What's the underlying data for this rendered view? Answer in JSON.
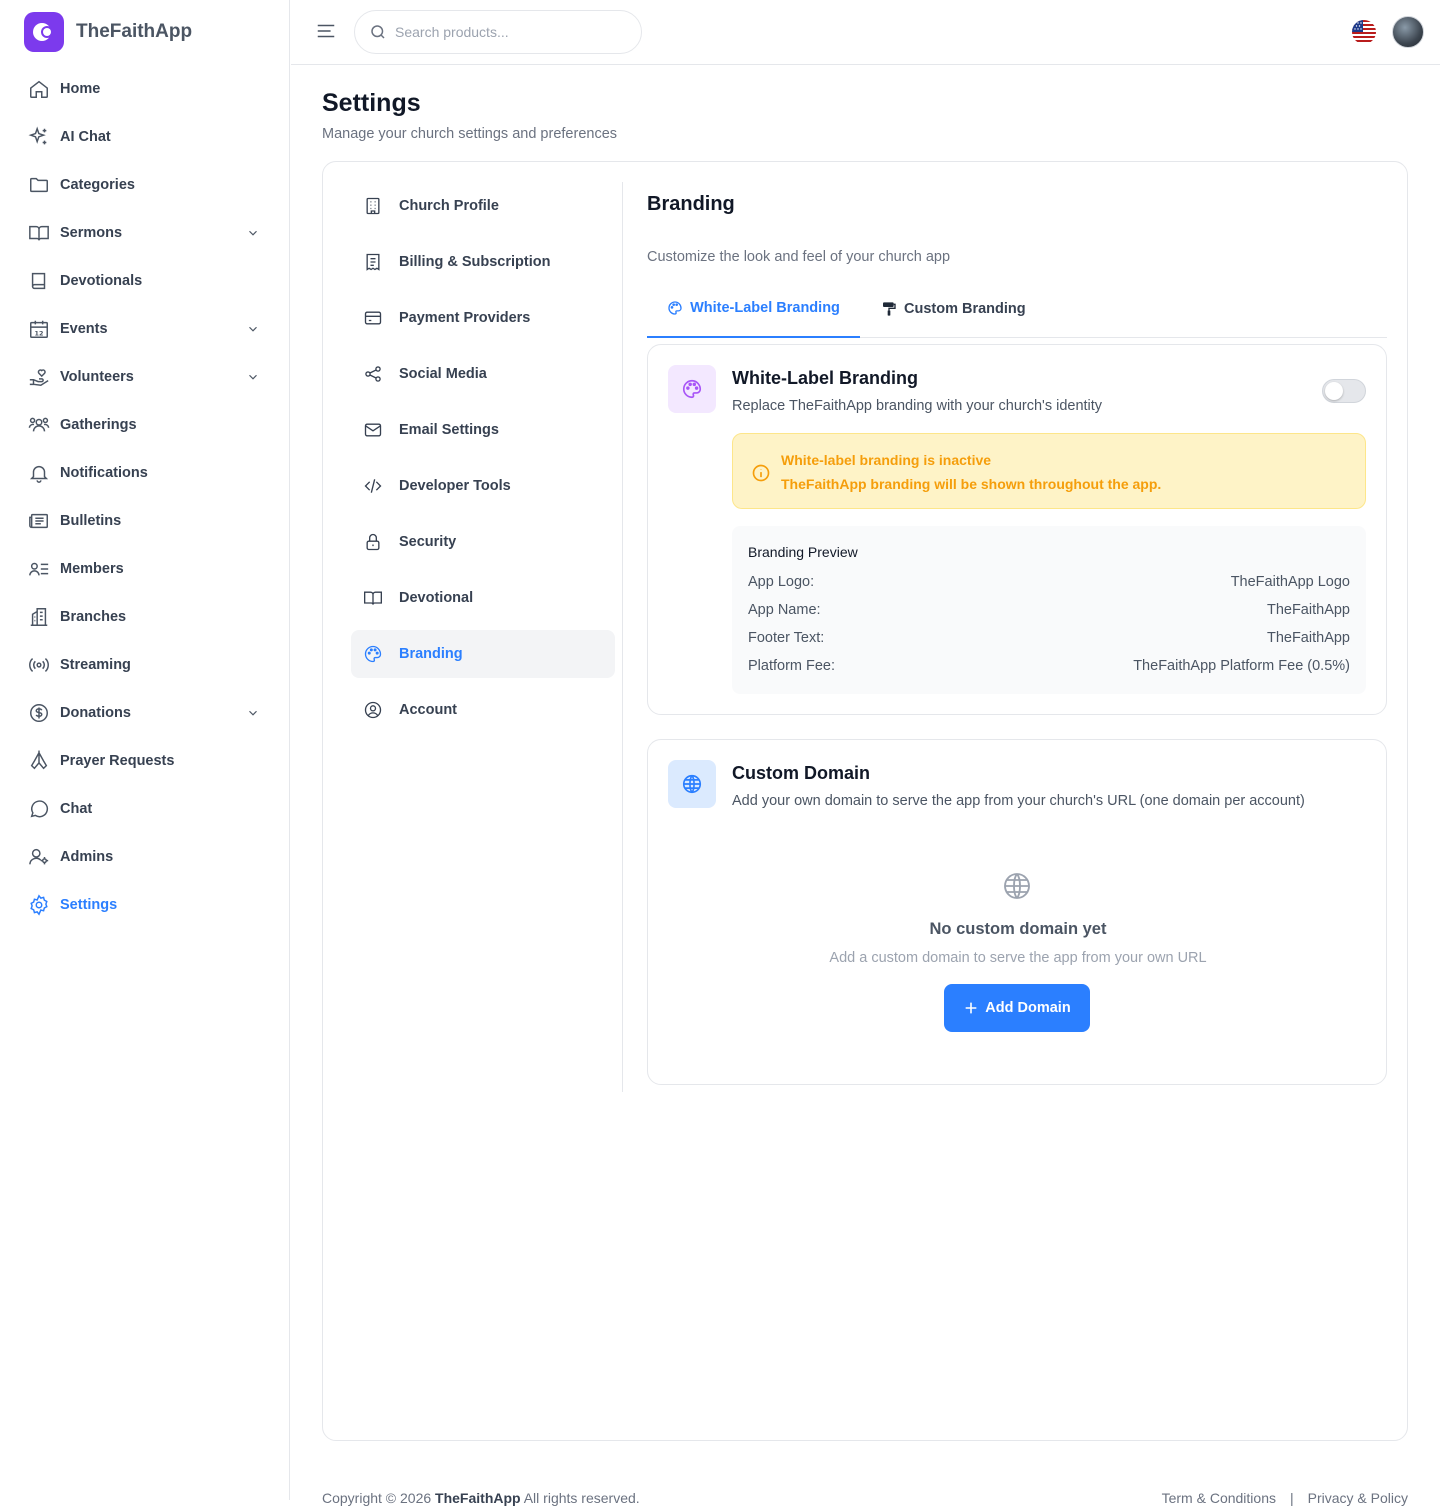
{
  "app": {
    "name": "TheFaithApp"
  },
  "sidebar": {
    "items": [
      {
        "label": "Home",
        "icon": "home-icon"
      },
      {
        "label": "AI Chat",
        "icon": "sparkles-icon"
      },
      {
        "label": "Categories",
        "icon": "folder-icon"
      },
      {
        "label": "Sermons",
        "icon": "book-open-icon",
        "expandable": true
      },
      {
        "label": "Devotionals",
        "icon": "book-icon"
      },
      {
        "label": "Events",
        "icon": "calendar-icon",
        "expandable": true
      },
      {
        "label": "Volunteers",
        "icon": "hand-heart-icon",
        "expandable": true
      },
      {
        "label": "Gatherings",
        "icon": "users-icon"
      },
      {
        "label": "Notifications",
        "icon": "bell-icon"
      },
      {
        "label": "Bulletins",
        "icon": "newspaper-icon"
      },
      {
        "label": "Members",
        "icon": "user-list-icon"
      },
      {
        "label": "Branches",
        "icon": "building-icon"
      },
      {
        "label": "Streaming",
        "icon": "radio-icon"
      },
      {
        "label": "Donations",
        "icon": "dollar-circle-icon",
        "expandable": true
      },
      {
        "label": "Prayer Requests",
        "icon": "praying-hands-icon"
      },
      {
        "label": "Chat",
        "icon": "message-circle-icon"
      },
      {
        "label": "Admins",
        "icon": "user-cog-icon"
      },
      {
        "label": "Settings",
        "icon": "gear-icon",
        "active": true
      }
    ]
  },
  "topbar": {
    "search_placeholder": "Search products..."
  },
  "page": {
    "title": "Settings",
    "subtitle": "Manage your church settings and preferences"
  },
  "settings_nav": {
    "items": [
      {
        "label": "Church Profile",
        "icon": "building-icon"
      },
      {
        "label": "Billing & Subscription",
        "icon": "receipt-icon"
      },
      {
        "label": "Payment Providers",
        "icon": "credit-card-icon"
      },
      {
        "label": "Social Media",
        "icon": "share-icon"
      },
      {
        "label": "Email Settings",
        "icon": "mail-icon"
      },
      {
        "label": "Developer Tools",
        "icon": "code-icon"
      },
      {
        "label": "Security",
        "icon": "lock-icon"
      },
      {
        "label": "Devotional",
        "icon": "book-open-icon"
      },
      {
        "label": "Branding",
        "icon": "palette-icon",
        "active": true
      },
      {
        "label": "Account",
        "icon": "user-circle-icon"
      }
    ]
  },
  "branding": {
    "title": "Branding",
    "subtitle": "Customize the look and feel of your church app",
    "tabs": [
      {
        "label": "White-Label Branding",
        "active": true
      },
      {
        "label": "Custom Branding"
      }
    ],
    "white_label": {
      "title": "White-Label Branding",
      "subtitle": "Replace TheFaithApp branding with your church's identity",
      "enabled": false,
      "alert_title": "White-label branding is inactive",
      "alert_text": "TheFaithApp branding will be shown throughout the app.",
      "preview_title": "Branding Preview",
      "preview_rows": [
        {
          "label": "App Logo:",
          "value": "TheFaithApp Logo"
        },
        {
          "label": "App Name:",
          "value": "TheFaithApp"
        },
        {
          "label": "Footer Text:",
          "value": "TheFaithApp"
        },
        {
          "label": "Platform Fee:",
          "value": "TheFaithApp Platform Fee (0.5%)"
        }
      ]
    },
    "custom_domain": {
      "title": "Custom Domain",
      "subtitle": "Add your own domain to serve the app from your church's URL (one domain per account)",
      "empty_title": "No custom domain yet",
      "empty_subtitle": "Add a custom domain to serve the app from your own URL",
      "add_button": "Add Domain"
    }
  },
  "footer": {
    "copyright_prefix": "Copyright © 2026",
    "brand": "TheFaithApp",
    "copyright_suffix": "All rights reserved.",
    "terms": "Term & Conditions",
    "separator": "|",
    "privacy": "Privacy & Policy"
  },
  "colors": {
    "accent": "#2b7fff",
    "brand": "#7c3aed",
    "warning": "#f59e0b",
    "warning_bg": "#fef3c7"
  }
}
